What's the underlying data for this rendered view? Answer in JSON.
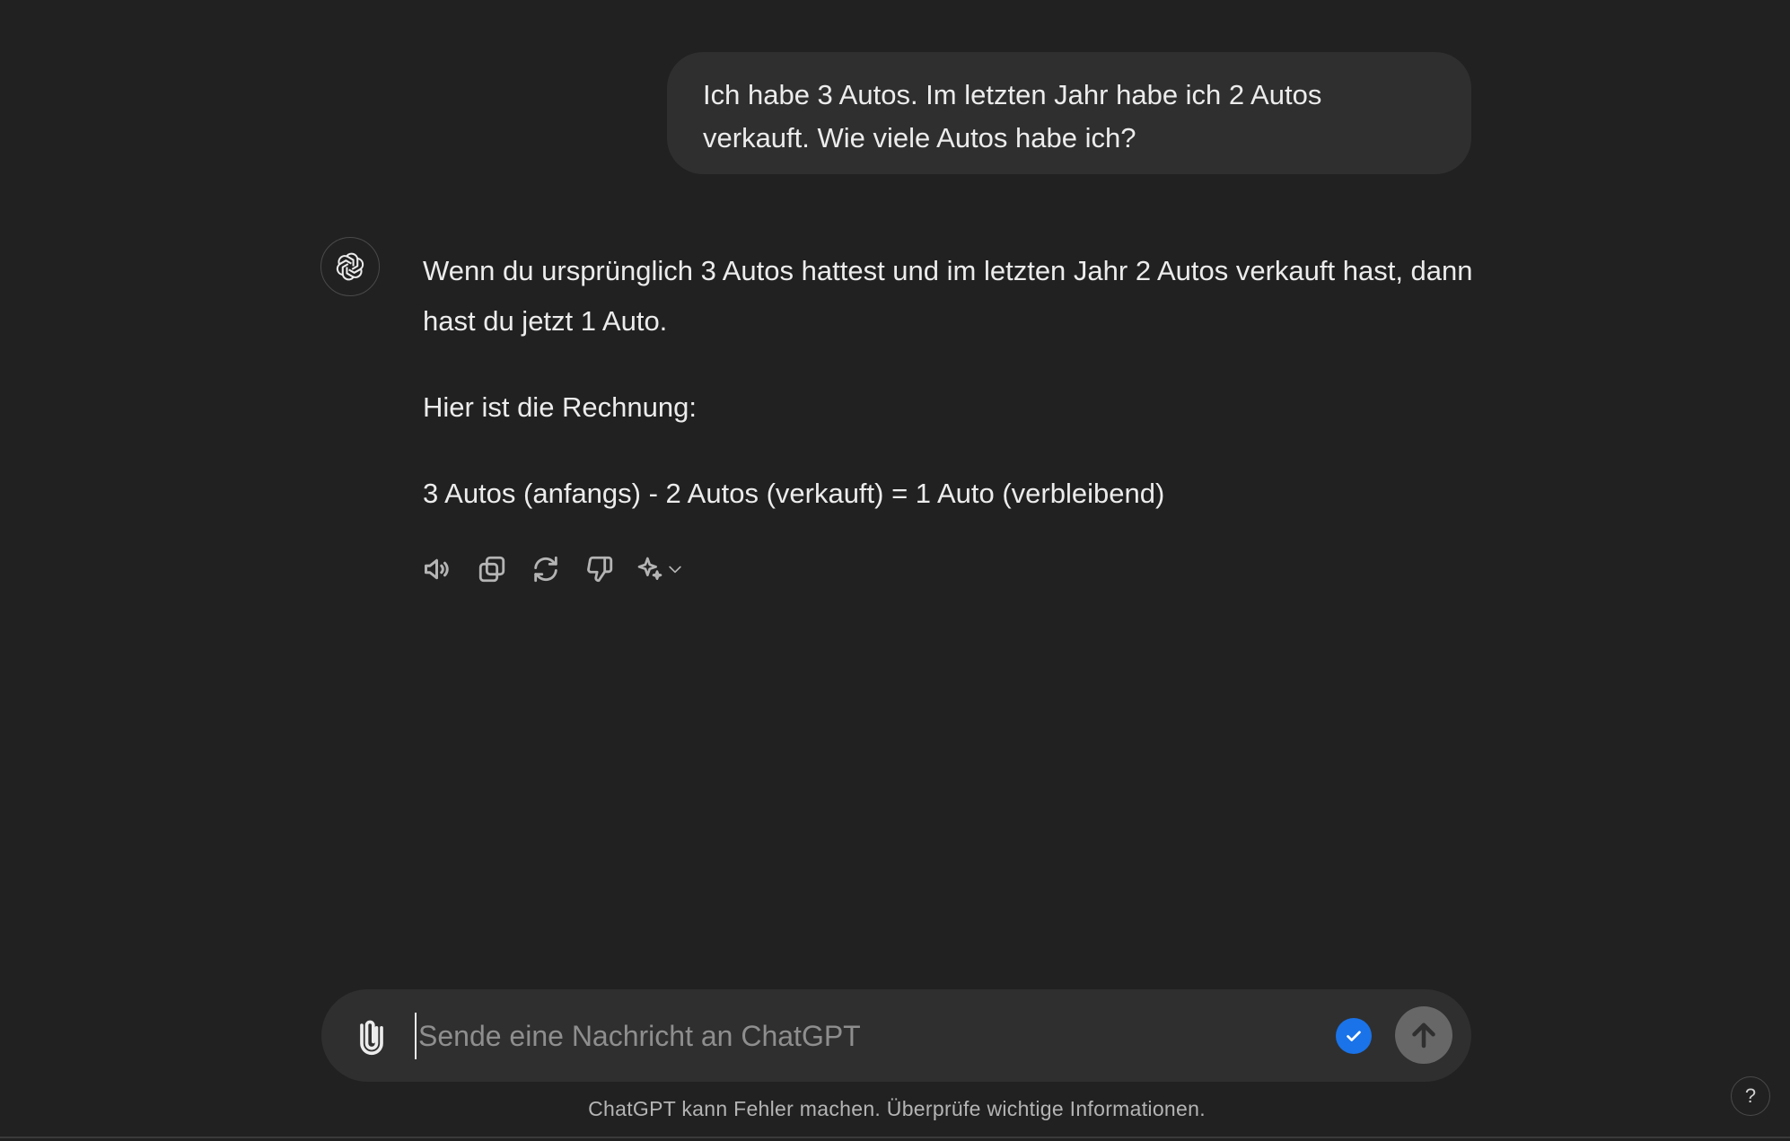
{
  "conversation": {
    "user_message": "Ich habe 3 Autos. Im letzten Jahr habe ich 2 Autos verkauft. Wie viele Autos habe ich?",
    "assistant_paragraphs": [
      "Wenn du ursprünglich 3 Autos hattest und im letzten Jahr 2 Autos verkauft hast, dann hast du jetzt 1 Auto.",
      "Hier ist die Rechnung:",
      "3 Autos (anfangs) - 2 Autos (verkauft) = 1 Auto (verbleibend)"
    ],
    "assistant_avatar_icon": "openai-logo-icon",
    "actions": [
      {
        "icon": "speaker-icon"
      },
      {
        "icon": "copy-icon"
      },
      {
        "icon": "regenerate-icon"
      },
      {
        "icon": "thumbs-down-icon"
      },
      {
        "icon": "sparkle-icon"
      }
    ]
  },
  "composer": {
    "placeholder": "Sende eine Nachricht an ChatGPT",
    "value": "",
    "attach_icon": "paperclip-icon",
    "check_icon": "check-icon",
    "send_icon": "arrow-up-icon",
    "check_color": "#1a73e8"
  },
  "footer": {
    "disclaimer": "ChatGPT kann Fehler machen. Überprüfe wichtige Informationen.",
    "help_label": "?"
  }
}
